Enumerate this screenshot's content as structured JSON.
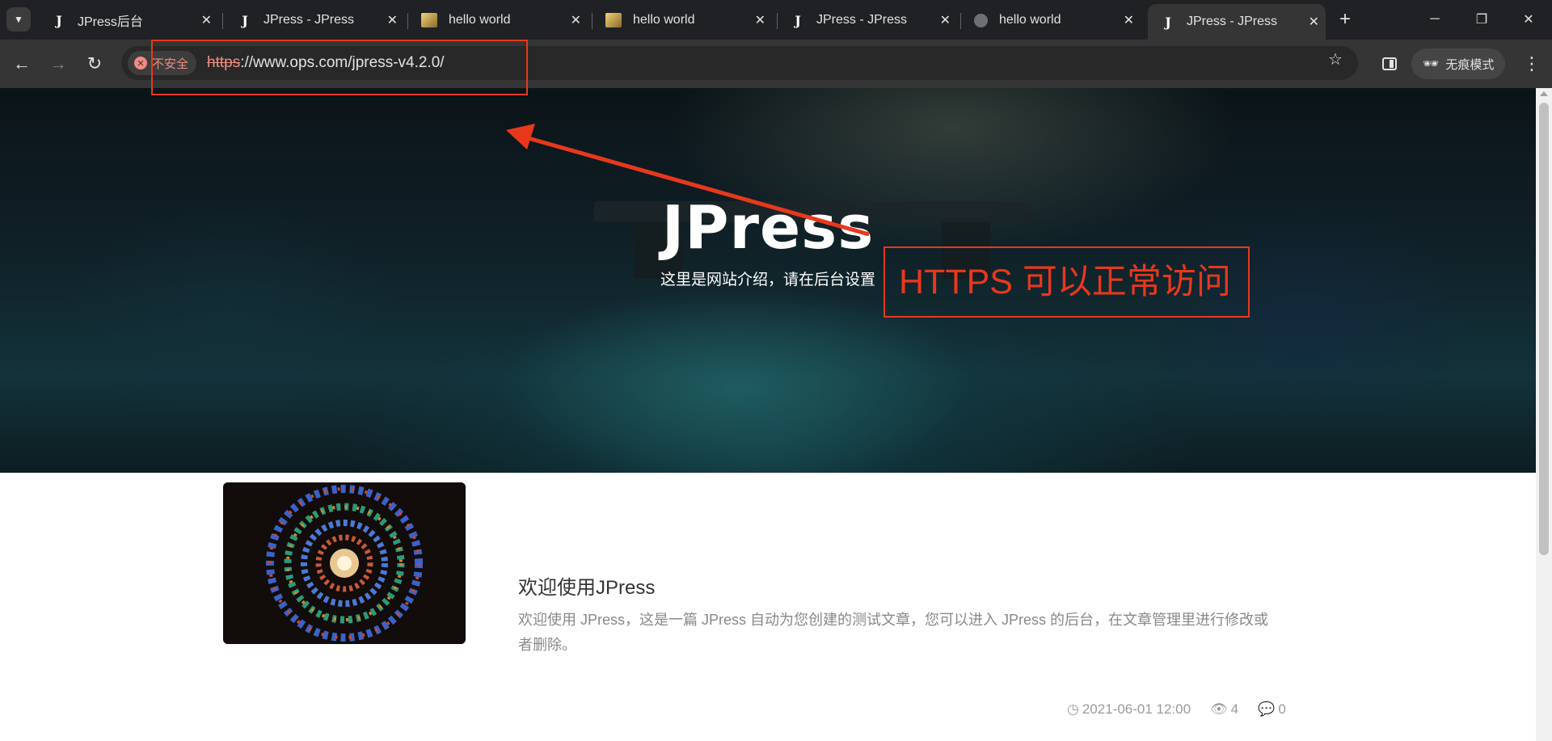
{
  "tabs": [
    {
      "title": "JPress后台",
      "favicon": "jpress-logo-icon",
      "active": false
    },
    {
      "title": "JPress - JPress",
      "favicon": "jpress-logo-icon",
      "active": false
    },
    {
      "title": "hello world",
      "favicon": "image-favicon-icon",
      "active": false
    },
    {
      "title": "hello world",
      "favicon": "image-favicon-icon",
      "active": false
    },
    {
      "title": "JPress - JPress",
      "favicon": "jpress-logo-icon",
      "active": false
    },
    {
      "title": "hello world",
      "favicon": "globe-icon",
      "active": false
    },
    {
      "title": "JPress - JPress",
      "favicon": "jpress-logo-icon",
      "active": true
    }
  ],
  "tab_favicon_letter": "J",
  "address_bar": {
    "security_label": "不安全",
    "url_scheme": "https",
    "url_rest": "://www.ops.com/jpress-v4.2.0/"
  },
  "toolbar": {
    "incognito_label": "无痕模式"
  },
  "hero": {
    "title": "JPress",
    "subtitle": "这里是网站介绍，请在后台设置"
  },
  "annotation": {
    "text": "HTTPS 可以正常访问",
    "color": "#e8381c"
  },
  "article": {
    "title": "欢迎使用JPress",
    "excerpt": "欢迎使用 JPress，这是一篇 JPress 自动为您创建的测试文章，您可以进入 JPress 的后台，在文章管理里进行修改或者删除。",
    "date": "2021-06-01 12:00",
    "views": "4",
    "comments": "0"
  },
  "colors": {
    "tabstrip_bg": "#202124",
    "toolbar_bg": "#353535",
    "insecure_red": "#f28b82"
  }
}
